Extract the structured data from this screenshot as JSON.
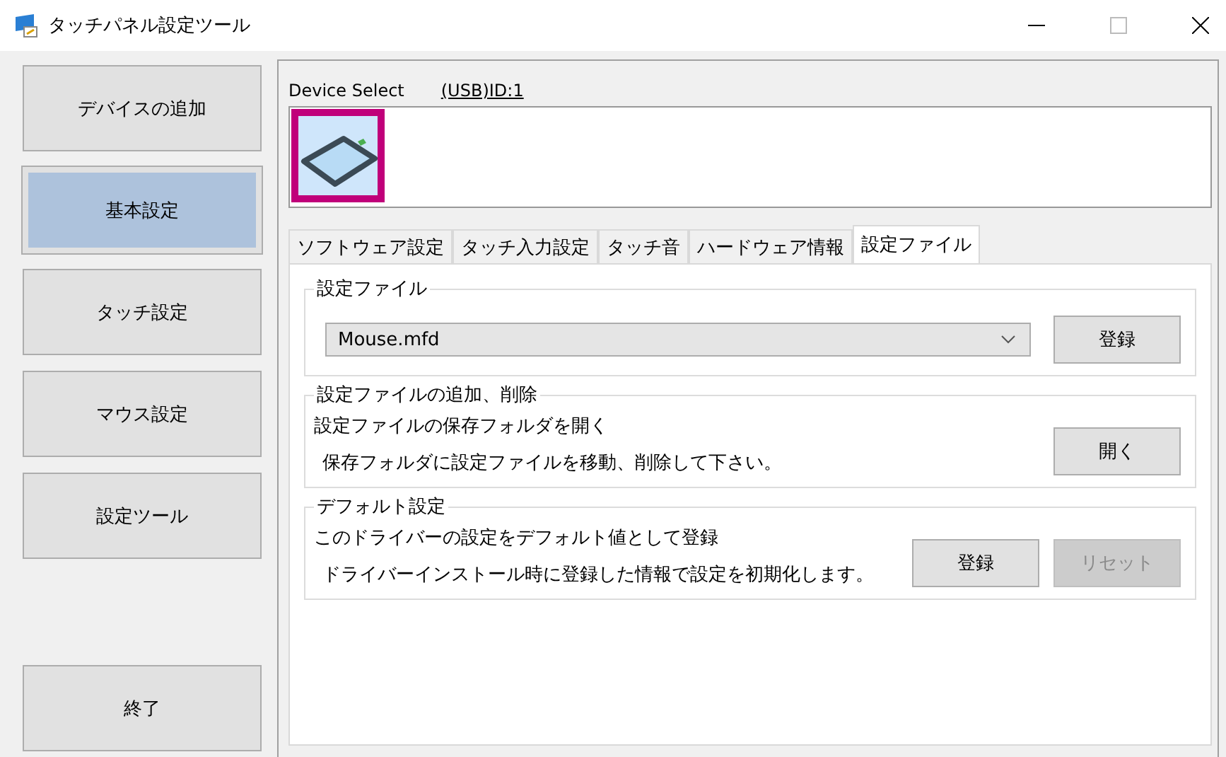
{
  "window": {
    "title": "タッチパネル設定ツール"
  },
  "sidebar": {
    "items": [
      {
        "label": "デバイスの追加",
        "selected": false
      },
      {
        "label": "基本設定",
        "selected": true
      },
      {
        "label": "タッチ設定",
        "selected": false
      },
      {
        "label": "マウス設定",
        "selected": false
      },
      {
        "label": "設定ツール",
        "selected": false
      }
    ],
    "exit_button": "終了"
  },
  "device_select": {
    "label": "Device Select",
    "device_id": "(USB)ID:1",
    "devices": [
      {
        "selected": true
      }
    ]
  },
  "tabs": [
    {
      "label": "ソフトウェア設定",
      "selected": false
    },
    {
      "label": "タッチ入力設定",
      "selected": false
    },
    {
      "label": "タッチ音",
      "selected": false
    },
    {
      "label": "ハードウェア情報",
      "selected": false
    },
    {
      "label": "設定ファイル",
      "selected": true
    }
  ],
  "groups": [
    {
      "title": "設定ファイル",
      "kind": "select",
      "value": "Mouse.mfd",
      "buttons": [
        {
          "label": "登録",
          "disabled": false
        }
      ]
    },
    {
      "title": "設定ファイルの追加、削除",
      "kind": "text",
      "lines": [
        "設定ファイルの保存フォルダを開く",
        "保存フォルダに設定ファイルを移動、削除して下さい。"
      ],
      "buttons": [
        {
          "label": "開く",
          "disabled": false
        }
      ]
    },
    {
      "title": "デフォルト設定",
      "kind": "text",
      "lines": [
        "このドライバーの設定をデフォルト値として登録",
        "ドライバーインストール時に登録した情報で設定を初期化します。"
      ],
      "buttons": [
        {
          "label": "登録",
          "disabled": false
        },
        {
          "label": "リセット",
          "disabled": true
        }
      ]
    }
  ]
}
